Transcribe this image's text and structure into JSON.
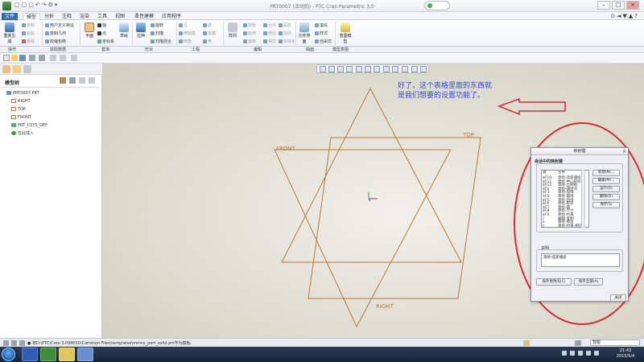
{
  "window": {
    "title": "PRT0007 (活动的) - PTC Creo Parametric 3.0"
  },
  "menu_tabs": [
    "文件",
    "模型",
    "分析",
    "注释",
    "渲染",
    "工具",
    "视图",
    "柔性建模",
    "应用程序"
  ],
  "ribbon": {
    "regenerate": "重新生成",
    "copy": "复制",
    "paste": "粘贴",
    "delete": "删除",
    "user_feature": "用户定义特征",
    "copy_geometry": "复制几何",
    "shrinkwrap": "收缩包络",
    "plane": "平面",
    "axis": "轴",
    "point": "点",
    "coord_sys": "坐标系",
    "sketch": "草绘",
    "extrude": "拉伸",
    "revolve": "旋转",
    "sweep": "扫描",
    "swept_blend": "扫描混合",
    "hole": "孔",
    "round": "倒圆角",
    "chamfer": "倒角",
    "shell": "壳",
    "draft": "拔模",
    "rib": "筋",
    "pattern": "阵列",
    "mirror": "镜像",
    "extend": "延伸",
    "trim": "修剪",
    "offset": "偏移",
    "merge": "合并",
    "intersect": "相交",
    "project": "投影",
    "thicken": "加厚",
    "solidify": "实体化",
    "fill": "填充",
    "style": "样式",
    "freestyle": "自由式",
    "component_interface": "元件界面",
    "intent_model": "意图模型"
  },
  "ribbon_groups": [
    "操作",
    "获取数据",
    "基准",
    "形状",
    "工程",
    "编辑",
    "曲面",
    "模型意图"
  ],
  "model_tree": {
    "title": "模型树",
    "items": [
      "PRT0007.PRT",
      "RIGHT",
      "TOP",
      "FRONT",
      "PRT_CSYS_DEF",
      "在此插入"
    ]
  },
  "datum_labels": {
    "front": "FRONT",
    "top": "TOP",
    "right": "RIGHT"
  },
  "annotation": {
    "text": "好了，这个表格里面的东西就是我们想要的设置功能了。",
    "color": "#3b45e0"
  },
  "dialog": {
    "title": "映射键",
    "group_mapkeys": "会话中的映射键",
    "col_key": "键",
    "col_name": "名称",
    "rows": [
      {
        "key": "$F10",
        "name": "草绘-选新捕捉"
      },
      {
        "key": "$F11",
        "name": "草绘-中心矩形"
      },
      {
        "key": "$F12",
        "name": "草绘-出侧视"
      },
      {
        "key": "$F2",
        "name": "草绘-捕捉点"
      },
      {
        "key": "$F3",
        "name": "草绘-弧线"
      },
      {
        "key": "$F4",
        "name": "草绘-圆线"
      },
      {
        "key": "$F5",
        "name": "草绘-直线"
      },
      {
        "key": "$F6",
        "name": "草绘-矩形"
      },
      {
        "key": "$F7",
        "name": "草绘-圆"
      },
      {
        "key": "$F8",
        "name": "草绘-尺寸"
      },
      {
        "key": "$F9",
        "name": "草绘-约束"
      },
      {
        "key": "c",
        "name": "编辑-复制"
      },
      {
        "key": "s",
        "name": "草绘-修剪"
      },
      {
        "key": "t",
        "name": "草绘-约束-相切"
      }
    ],
    "btn_new": "新建(N)...",
    "btn_modify": "编辑(M)...",
    "btn_run": "运行(R)",
    "btn_delete": "删除(D)",
    "btn_save": "保存(S)",
    "group_description": "说明",
    "description_value": "草绘-选新捕捉",
    "btn_save_changed": "保存更改的(C)",
    "btn_save_all": "保存全部(A)",
    "btn_close": "关闭"
  },
  "status": {
    "message": "● 将D:\\PTC\\Creo 3.0\\M030\\Common Files\\templates\\mmns_part_solid.prt作为模板。",
    "filter": "智能"
  },
  "taskbar": {
    "time": "21:43",
    "date": "2015/5/4"
  },
  "colors": {
    "datum_plane": "#b9783a",
    "annotation_ellipse": "#e0263a",
    "arrow": "#e0263a"
  }
}
